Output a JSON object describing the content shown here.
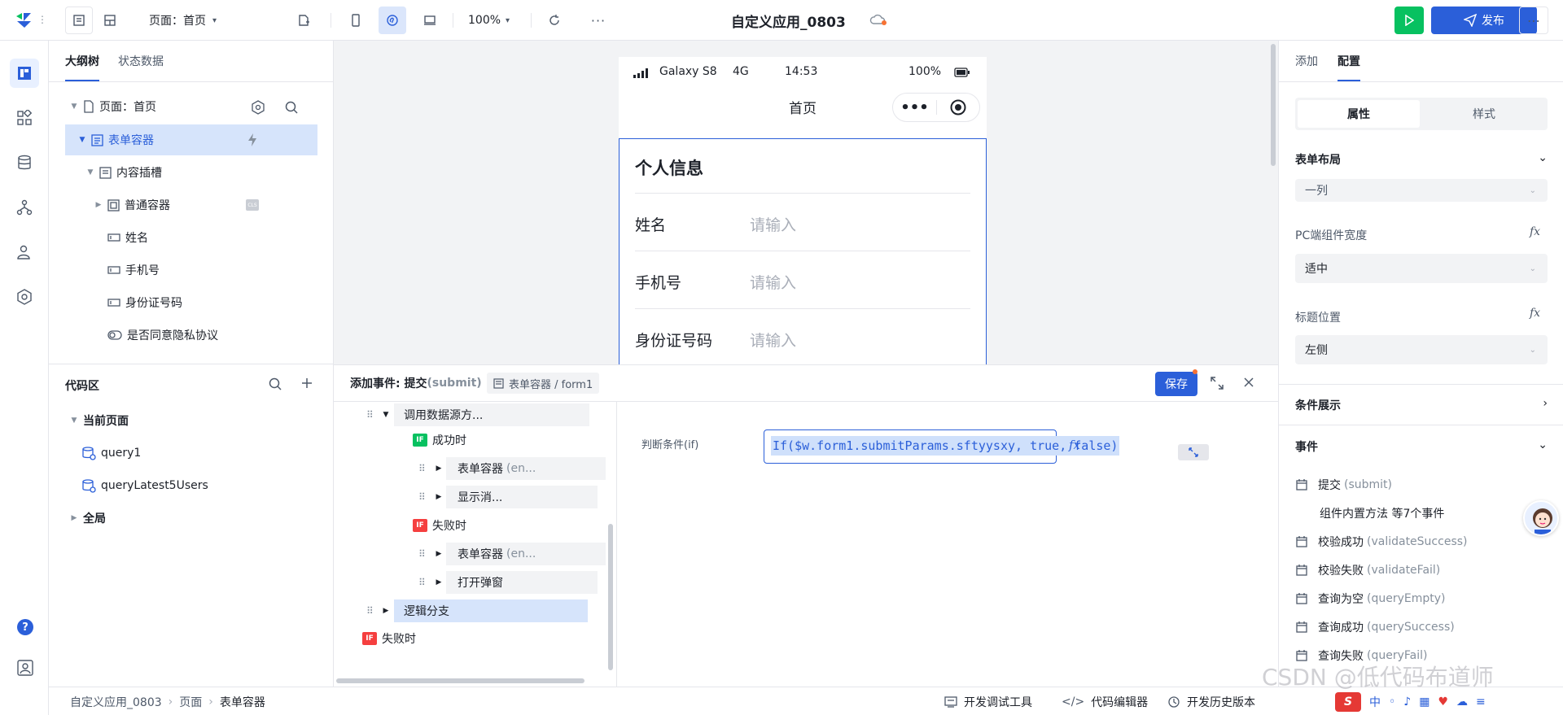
{
  "topbar": {
    "page_label": "页面：首页",
    "zoom": "100%",
    "app_title": "自定义应用_0803",
    "publish_label": "发布"
  },
  "outline": {
    "tabs": [
      "大纲树",
      "状态数据"
    ],
    "items": [
      {
        "label": "页面：首页"
      },
      {
        "label": "表单容器"
      },
      {
        "label": "内容插槽"
      },
      {
        "label": "普通容器"
      },
      {
        "label": "姓名"
      },
      {
        "label": "手机号"
      },
      {
        "label": "身份证号码"
      },
      {
        "label": "是否同意隐私协议"
      }
    ]
  },
  "code": {
    "title": "代码区",
    "current_page": "当前页面",
    "queries": [
      "query1",
      "queryLatest5Users"
    ],
    "global": "全局"
  },
  "phone": {
    "device": "Galaxy S8",
    "network": "4G",
    "time": "14:53",
    "battery": "100%",
    "nav_title": "首页",
    "form_title": "个人信息",
    "fields": [
      {
        "label": "姓名",
        "placeholder": "请输入"
      },
      {
        "label": "手机号",
        "placeholder": "请输入"
      },
      {
        "label": "身份证号码",
        "placeholder": "请输入"
      }
    ]
  },
  "event": {
    "header": "添加事件: 提交",
    "header_en": "(submit)",
    "crumb": "表单容器 / form1",
    "save": "保存",
    "nodes": {
      "datasource": "调用数据源方...",
      "success": "成功时",
      "form_en": "表单容器",
      "form_en_suffix": "(en...",
      "show_msg": "显示消...",
      "fail": "失败时",
      "form_en2": "表单容器",
      "form_en2_suffix": "(en...",
      "open_modal": "打开弹窗",
      "branch": "逻辑分支",
      "fail2": "失败时"
    },
    "cond_label": "判断条件(if)",
    "cond_value": "If($w.form1.submitParams.sftyysxy, true, false)"
  },
  "right": {
    "tabs": [
      "添加",
      "配置"
    ],
    "seg": [
      "属性",
      "样式"
    ],
    "layout_title": "表单布局",
    "layout_value": "一列",
    "pc_width_label": "PC端组件宽度",
    "pc_width_value": "适中",
    "title_pos_label": "标题位置",
    "title_pos_value": "左侧",
    "cond_show": "条件展示",
    "events_title": "事件",
    "events": [
      {
        "zh": "提交",
        "en": "(submit)"
      },
      {
        "zh": "组件内置方法 等7个事件",
        "en": ""
      },
      {
        "zh": "校验成功",
        "en": "(validateSuccess)"
      },
      {
        "zh": "校验失败",
        "en": "(validateFail)"
      },
      {
        "zh": "查询为空",
        "en": "(queryEmpty)"
      },
      {
        "zh": "查询成功",
        "en": "(querySuccess)"
      },
      {
        "zh": "查询失败",
        "en": "(queryFail)"
      }
    ]
  },
  "status": {
    "crumbs": [
      "自定义应用_0803",
      "页面",
      "表单容器"
    ],
    "tools": [
      "开发调试工具",
      "代码编辑器",
      "开发历史版本"
    ],
    "watermark": "CSDN @低代码布道师"
  },
  "colors": {
    "primary": "#2b5fd9",
    "green": "#07c160",
    "red": "#f53f3f"
  }
}
